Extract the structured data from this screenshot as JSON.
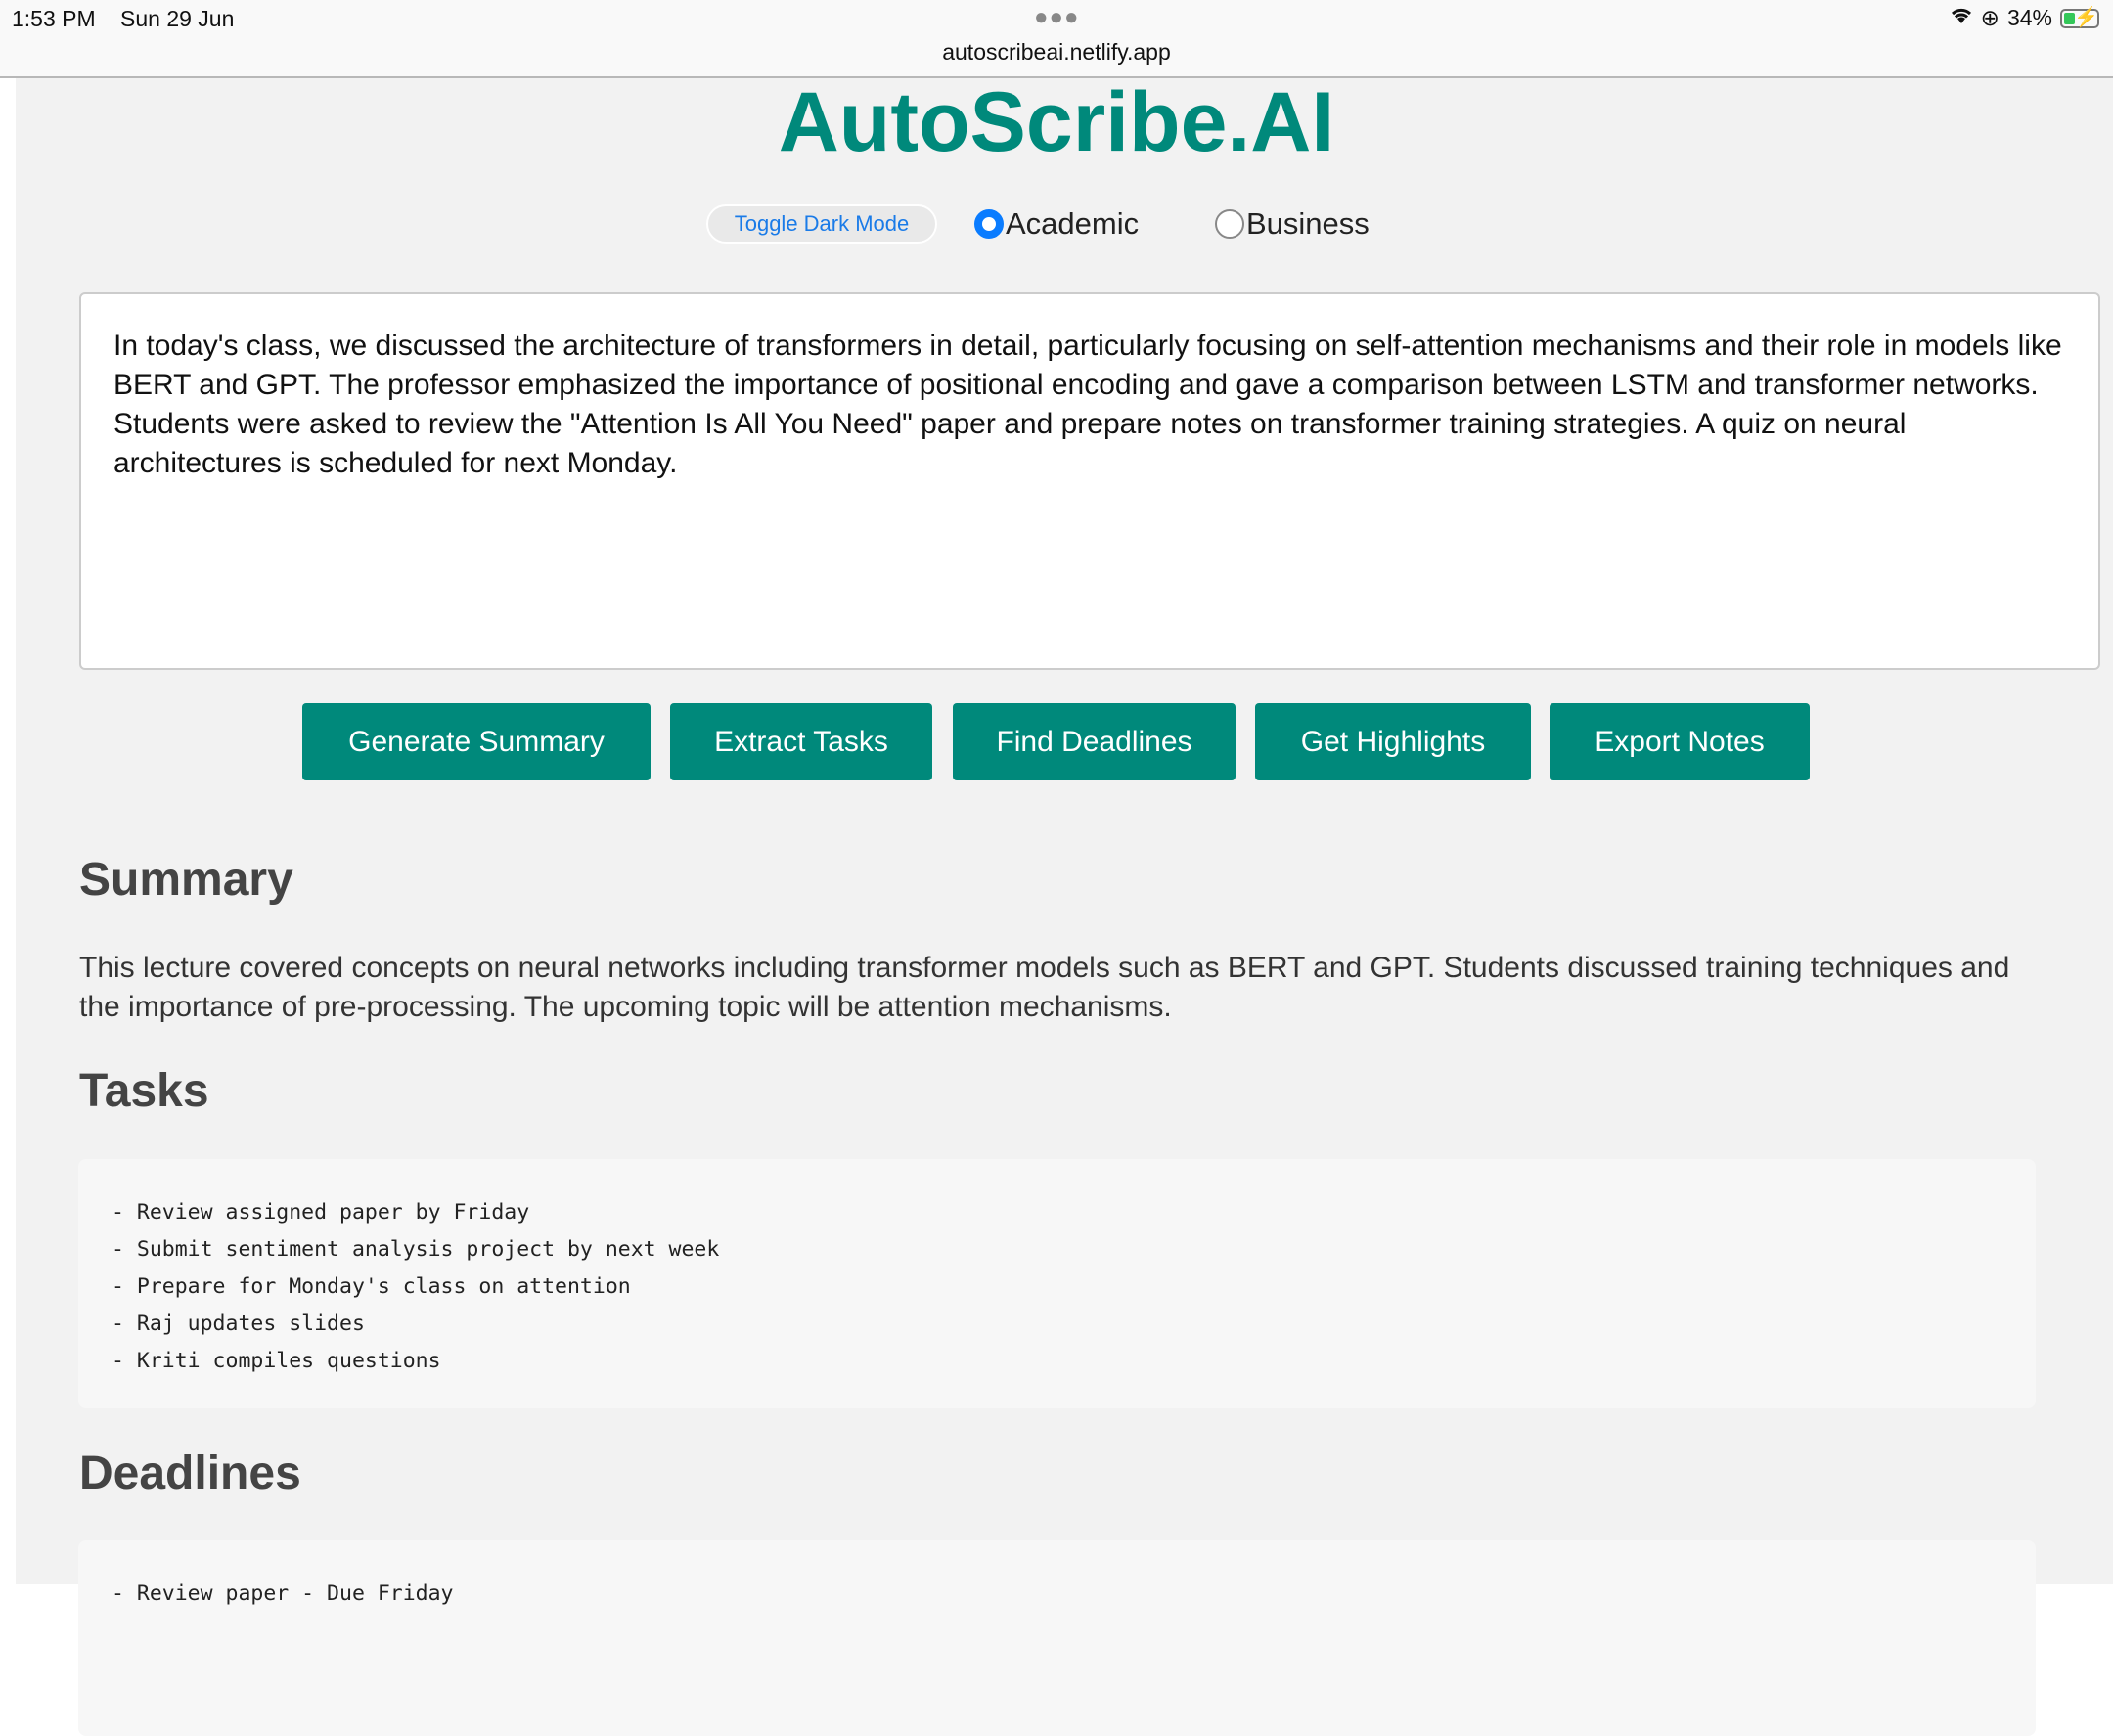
{
  "status_bar": {
    "time": "1:53 PM",
    "date": "Sun 29 Jun",
    "battery": "34%",
    "battery_level": 0.34,
    "url": "autoscribeai.netlify.app"
  },
  "app": {
    "title": "AutoScribe.AI",
    "toggle_dark_mode": "Toggle Dark Mode",
    "modes": [
      {
        "label": "Academic",
        "selected": true
      },
      {
        "label": "Business",
        "selected": false
      }
    ],
    "accent_color": "#00897b"
  },
  "input": {
    "value": "In today's class, we discussed the architecture of transformers in detail, particularly focusing on self-attention mechanisms and their role in models like BERT and GPT. The professor emphasized the importance of positional encoding and gave a comparison between LSTM and transformer networks. Students were asked to review the \"Attention Is All You Need\" paper and prepare notes on transformer training strategies. A quiz on neural architectures is scheduled for next Monday."
  },
  "actions": [
    "Generate Summary",
    "Extract Tasks",
    "Find Deadlines",
    "Get Highlights",
    "Export Notes"
  ],
  "summary": {
    "heading": "Summary",
    "text": "This lecture covered concepts on neural networks including transformer models such as BERT and GPT. Students discussed training techniques and the importance of pre-processing. The upcoming topic will be attention mechanisms."
  },
  "tasks": {
    "heading": "Tasks",
    "items": [
      "- Review assigned paper by Friday",
      "- Submit sentiment analysis project by next week",
      "- Prepare for Monday's class on attention",
      "- Raj updates slides",
      "- Kriti compiles questions"
    ]
  },
  "deadlines": {
    "heading": "Deadlines",
    "items": [
      "- Review paper - Due Friday"
    ]
  }
}
